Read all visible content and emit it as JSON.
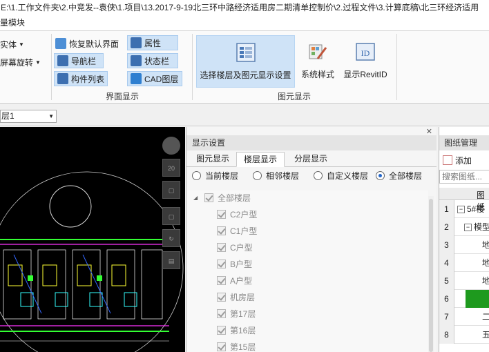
{
  "titlebar": {
    "path": "E:\\1.工作文件夹\\2.中竞发--袁侠\\1.项目\\13.2017-9-19北三环中路经济适用房二期清单控制价\\2.过程文件\\3.计算底稿\\北三环经济适用"
  },
  "menubar": {
    "item": "量模块"
  },
  "ribbon": {
    "left_items": [
      {
        "label": "实体"
      },
      {
        "label": "屏幕旋转"
      }
    ],
    "ui_group": {
      "label": "界面显示",
      "items": [
        {
          "label": "恢复默认界面"
        },
        {
          "label": "属性"
        },
        {
          "label": "导航栏"
        },
        {
          "label": "状态栏"
        },
        {
          "label": "构件列表"
        },
        {
          "label": "CAD图层"
        }
      ]
    },
    "elem_group": {
      "label": "图元显示",
      "items": [
        {
          "label": "选择楼层及图元显示设置"
        },
        {
          "label": "系统样式"
        },
        {
          "label": "显示RevitID"
        }
      ]
    }
  },
  "toolstrip": {
    "floor_value": "层1"
  },
  "viewtools": {
    "zoom_badge": "20"
  },
  "display_panel": {
    "title": "显示设置",
    "tabs": [
      {
        "label": "图元显示"
      },
      {
        "label": "楼层显示"
      },
      {
        "label": "分层显示"
      }
    ],
    "radios": [
      {
        "label": "当前楼层"
      },
      {
        "label": "相邻楼层"
      },
      {
        "label": "自定义楼层"
      },
      {
        "label": "全部楼层"
      }
    ],
    "tree_root": "全部楼层",
    "tree_items": [
      {
        "label": "C2户型"
      },
      {
        "label": "C1户型"
      },
      {
        "label": "C户型"
      },
      {
        "label": "B户型"
      },
      {
        "label": "A户型"
      },
      {
        "label": "机房层"
      },
      {
        "label": "第17层"
      },
      {
        "label": "第16层"
      },
      {
        "label": "第15层"
      }
    ]
  },
  "drawing_panel": {
    "title": "图纸管理",
    "add_label": "添加",
    "search_placeholder": "搜索图纸...",
    "col_header": "图纸",
    "rows": [
      {
        "num": "1",
        "text": "5#楼"
      },
      {
        "num": "2",
        "text": "模型"
      },
      {
        "num": "3",
        "text": "地"
      },
      {
        "num": "4",
        "text": "地"
      },
      {
        "num": "5",
        "text": "地"
      },
      {
        "num": "6",
        "text": ""
      },
      {
        "num": "7",
        "text": "二"
      },
      {
        "num": "8",
        "text": "五"
      }
    ]
  }
}
